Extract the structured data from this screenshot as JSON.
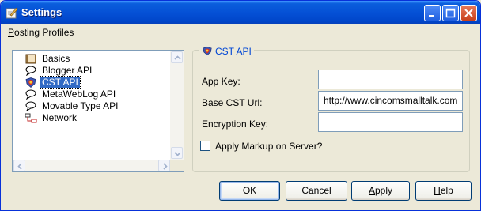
{
  "window": {
    "title": "Settings"
  },
  "menubar": {
    "items": [
      {
        "label": "Posting Profiles"
      }
    ]
  },
  "tree": {
    "items": [
      {
        "label": "Basics",
        "icon": "book-icon",
        "selected": false
      },
      {
        "label": "Blogger API",
        "icon": "speech-bubble-icon",
        "selected": false
      },
      {
        "label": "CST API",
        "icon": "shield-icon",
        "selected": true
      },
      {
        "label": "MetaWebLog API",
        "icon": "speech-bubble-icon",
        "selected": false
      },
      {
        "label": "Movable Type API",
        "icon": "speech-bubble-icon",
        "selected": false
      },
      {
        "label": "Network",
        "icon": "network-icon",
        "selected": false
      }
    ]
  },
  "group": {
    "title": "CST API",
    "icon": "shield-icon"
  },
  "fields": {
    "app_key": {
      "label": "App Key:",
      "value": ""
    },
    "base_url": {
      "label": "Base CST Url:",
      "value": "http://www.cincomsmalltalk.com"
    },
    "encryption_key": {
      "label": "Encryption Key:",
      "value": ""
    }
  },
  "checkbox": {
    "label": "Apply Markup on Server?",
    "checked": false
  },
  "buttons": {
    "ok": "OK",
    "cancel": "Cancel",
    "apply": "Apply",
    "help": "Help"
  },
  "colors": {
    "titlebar": "#0551d6",
    "selection": "#316ac5",
    "group_title": "#0046d5",
    "face": "#ece9d8"
  }
}
